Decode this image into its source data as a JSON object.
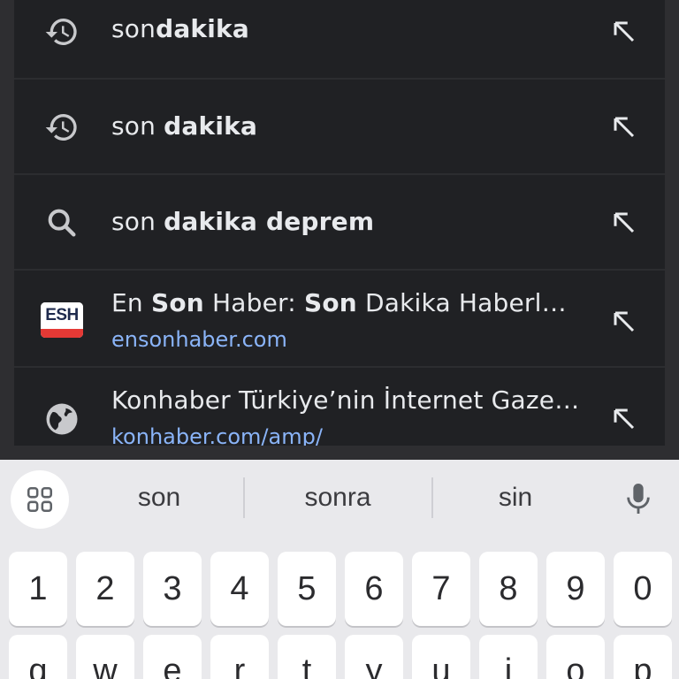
{
  "suggestions": [
    {
      "kind": "history",
      "icon": "history-icon",
      "plain": "son",
      "bold": "dakika"
    },
    {
      "kind": "history",
      "icon": "history-icon",
      "plain": "son ",
      "bold": "dakika"
    },
    {
      "kind": "search",
      "icon": "search-icon",
      "plain": "son ",
      "bold": "dakika deprem"
    },
    {
      "kind": "site",
      "icon": "esh-favicon-icon",
      "favicon_text": "ESH",
      "title_parts": [
        "En ",
        "Son",
        " Haber: ",
        "Son",
        " Dakika Haberler,..."
      ],
      "url": "ensonhaber.com"
    },
    {
      "kind": "site",
      "icon": "globe-icon",
      "title": "Konhaber Türkiye’nin İnternet Gazet...",
      "url": "konhaber.com/amp/"
    }
  ],
  "keyboard": {
    "suggestion_words": [
      "son",
      "sonra",
      "sin"
    ],
    "number_row": [
      "1",
      "2",
      "3",
      "4",
      "5",
      "6",
      "7",
      "8",
      "9",
      "0"
    ],
    "letter_row": [
      "q",
      "w",
      "e",
      "r",
      "t",
      "y",
      "u",
      "i",
      "o",
      "p"
    ]
  },
  "colors": {
    "panel_bg": "#202124",
    "text": "#e8eaed",
    "url": "#8ab4f8",
    "keyboard_bg": "#e9e9ec",
    "esh_red": "#e53935"
  }
}
